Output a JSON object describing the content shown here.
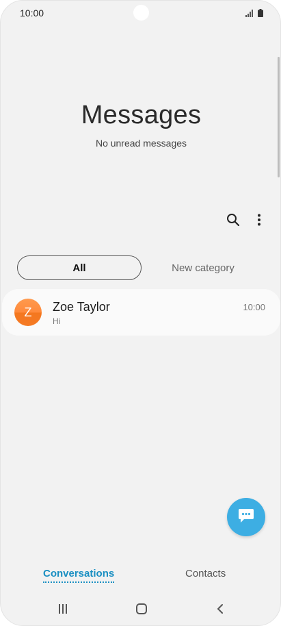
{
  "status_bar": {
    "time": "10:00"
  },
  "header": {
    "title": "Messages",
    "subtitle": "No unread messages"
  },
  "toolbar": {
    "search_icon": "search-icon",
    "more_icon": "more-vertical-icon"
  },
  "category_tabs": [
    {
      "label": "All",
      "selected": true
    },
    {
      "label": "New category",
      "selected": false
    }
  ],
  "conversations": [
    {
      "avatar_initial": "Z",
      "name": "Zoe Taylor",
      "preview": "Hi",
      "time": "10:00",
      "avatar_color": "#f7872e"
    }
  ],
  "fab": {
    "icon": "new-message-icon",
    "color": "#3daee3"
  },
  "bottom_tabs": [
    {
      "label": "Conversations",
      "active": true
    },
    {
      "label": "Contacts",
      "active": false
    }
  ],
  "nav_bar": {
    "recent_icon": "recent-apps-icon",
    "home_icon": "home-icon",
    "back_icon": "back-icon"
  },
  "colors": {
    "accent": "#1a8fc2",
    "background": "#f2f2f2"
  }
}
